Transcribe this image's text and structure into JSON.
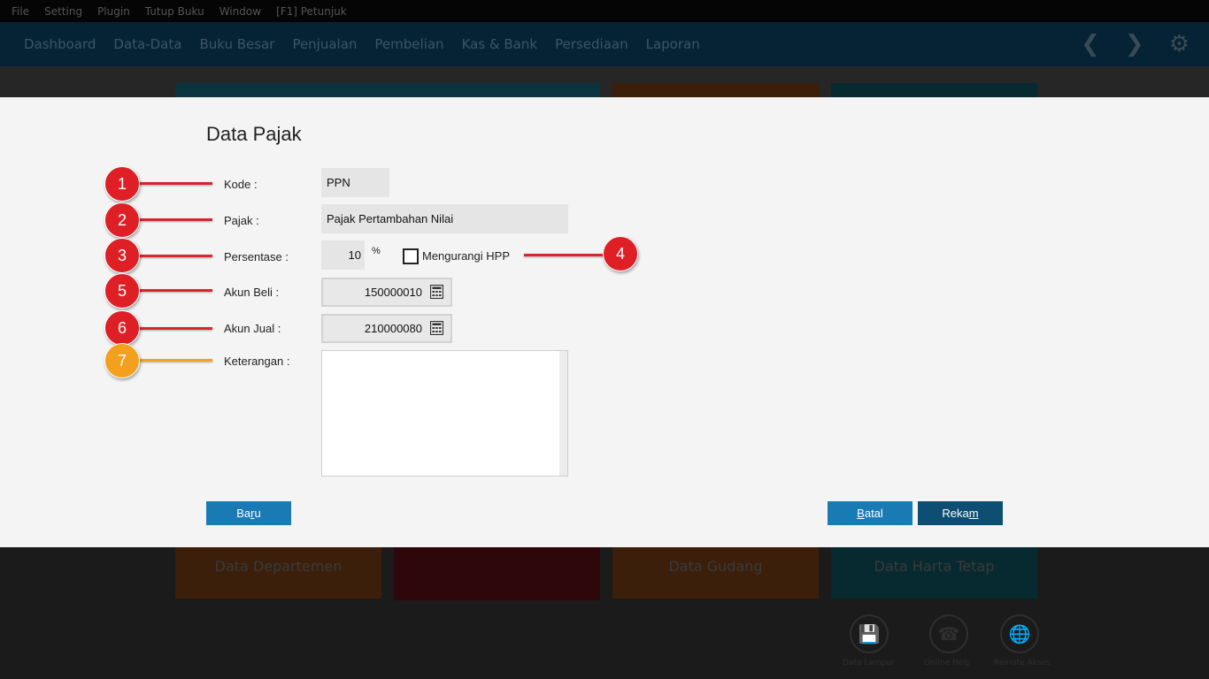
{
  "menubar": {
    "items": [
      "File",
      "Setting",
      "Plugin",
      "Tutup Buku",
      "Window",
      "[F1] Petunjuk"
    ]
  },
  "nav": {
    "items": [
      "Dashboard",
      "Data-Data",
      "Buku Besar",
      "Penjualan",
      "Pembelian",
      "Kas & Bank",
      "Persediaan",
      "Laporan"
    ],
    "back_icon": "chevron-left-icon",
    "forward_icon": "chevron-right-icon",
    "settings_icon": "gear-icon"
  },
  "tiles": {
    "departemen": "Data Departemen",
    "gudang": "Data Gudang",
    "harta": "Data Harta Tetap",
    "colors": {
      "teal": "#0b3440",
      "orange": "#3b1f0a",
      "red": "#2d0709",
      "darkteal": "#072a30"
    }
  },
  "bottom_icons": {
    "items": [
      {
        "icon": "save-icon",
        "label": "Data Lampur"
      },
      {
        "icon": "phone-icon",
        "label": "Online Help"
      },
      {
        "icon": "globe-icon",
        "label": "Remote Akses"
      }
    ]
  },
  "dialog": {
    "title": "Data Pajak",
    "labels": {
      "kode": "Kode :",
      "pajak": "Pajak :",
      "persentase": "Persentase :",
      "akun_beli": "Akun Beli :",
      "akun_jual": "Akun Jual :",
      "keterangan": "Keterangan :"
    },
    "values": {
      "kode": "PPN",
      "pajak": "Pajak Pertambahan Nilai",
      "persentase": "10",
      "percent_sign": "%",
      "akun_beli": "150000010",
      "akun_jual": "210000080",
      "keterangan": ""
    },
    "checkbox": {
      "label": "Mengurangi HPP",
      "checked": false
    },
    "buttons": {
      "baru": {
        "pre": "Ba",
        "ul": "r",
        "post": "u"
      },
      "batal": {
        "pre": "",
        "ul": "B",
        "post": "atal"
      },
      "rekam": {
        "pre": "Reka",
        "ul": "m",
        "post": ""
      }
    },
    "colors": {
      "primary": "#1a7ab3",
      "primary_dark": "#0e4e72",
      "background": "#f4f4f4"
    }
  },
  "callouts": [
    "1",
    "2",
    "3",
    "4",
    "5",
    "6",
    "7"
  ],
  "callout_colors": {
    "red": "#de1f26",
    "orange": "#f2a01e"
  }
}
